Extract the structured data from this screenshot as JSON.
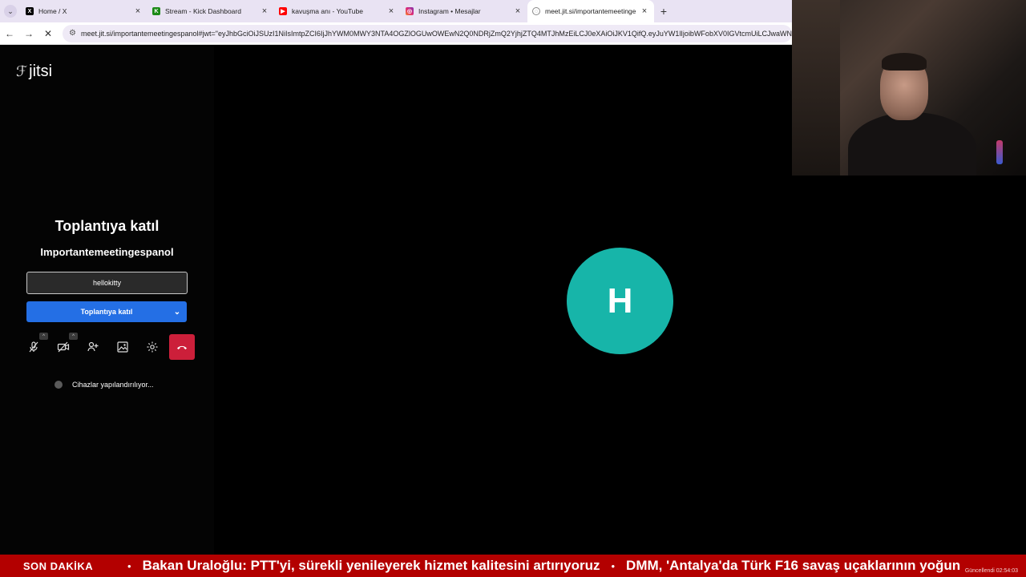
{
  "browser": {
    "tabs": [
      {
        "title": "Home / X",
        "icon": "x-logo-icon",
        "active": false,
        "color": "#000000"
      },
      {
        "title": "Stream - Kick Dashboard",
        "icon": "kick-logo-icon",
        "active": false,
        "color": "#53fc18"
      },
      {
        "title": "kavuşma anı - YouTube",
        "icon": "youtube-icon",
        "active": false,
        "color": "#ff0000"
      },
      {
        "title": "Instagram • Mesajlar",
        "icon": "instagram-icon",
        "active": false,
        "color": "#e1306c"
      },
      {
        "title": "meet.jit.si/importantemeetinge",
        "icon": "globe-icon",
        "active": true,
        "color": "#777777"
      }
    ],
    "url": "meet.jit.si/importantemeetingespanol#jwt=\"eyJhbGciOiJSUzI1NiIsImtpZCI6IjJhYWM0MWY3NTA4OGZlOGUwOWEwN2Q0NDRjZmQ2YjhjZTQ4MTJhMzEiLCJ0eXAiOiJKV1QifQ.eyJuYW1lIjoibWFobXV0IGVtcmUiLCJwaWN"
  },
  "jitsi": {
    "logo_text": "jitsi",
    "join_title": "Toplantıya katıl",
    "room_name": "Importantemeetingespanol",
    "name_input_value": "hellokitty",
    "join_button_label": "Toplantıya katıl",
    "status_text": "Cihazlar yapılandırılıyor...",
    "controls": [
      "microphone-off-icon",
      "camera-off-icon",
      "invite-icon",
      "background-icon",
      "settings-icon",
      "hangup-icon"
    ],
    "accent_color": "#246fe5",
    "hangup_color": "#cc1f3a"
  },
  "stage": {
    "avatar_initial": "H",
    "avatar_color": "#17b5a9"
  },
  "ticker": {
    "label": "SON DAKİKA",
    "headlines": [
      "Bakan Uraloğlu: PTT'yi, sürekli yenileyerek hizmet kalitesini artırıyoruz",
      "DMM, 'Antalya'da Türk F16 savaş uçaklarının yoğun"
    ],
    "updated": "Güncellendi 02:54:03"
  }
}
